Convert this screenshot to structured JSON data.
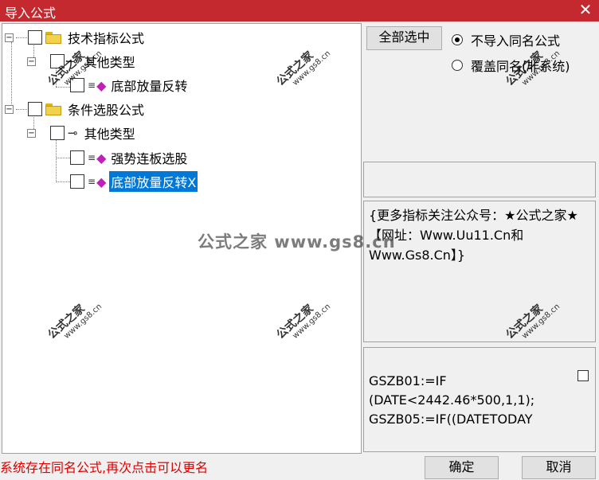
{
  "window": {
    "title": "导入公式",
    "close_glyph": "✕"
  },
  "tree": {
    "group1": {
      "label": "技术指标公式",
      "expander": "−"
    },
    "group1_type": {
      "label": "其他类型",
      "expander": "−"
    },
    "group1_item1": {
      "label": "底部放量反转"
    },
    "group2": {
      "label": "条件选股公式",
      "expander": "−"
    },
    "group2_type": {
      "label": "其他类型",
      "expander": "−"
    },
    "group2_item1": {
      "label": "强势连板选股"
    },
    "group2_item2": {
      "label": "底部放量反转X"
    }
  },
  "controls": {
    "select_all": "全部选中",
    "radio_no_import": "不导入同名公式",
    "radio_overwrite": "覆盖同名(非系统)",
    "radio_selected": "no_import"
  },
  "description": {
    "text": "{更多指标关注公众号：★公式之家★【网址：Www.Uu11.Cn和Www.Gs8.Cn】}"
  },
  "code": {
    "line1": "GSZB01:=IF",
    "line2": "(DATE<2442.46*500,1,1);",
    "line3": "GSZB05:=IF((DATETODAY"
  },
  "status": {
    "message": "系统存在同名公式,再次点击可以更名"
  },
  "buttons": {
    "ok": "确定",
    "cancel": "取消"
  },
  "watermark": {
    "main": "公式之家 www.gs8.cn",
    "stamp_cn": "公式之家",
    "stamp_url": "www.gs8.cn"
  },
  "icons": {
    "folder": "folder-icon",
    "key": "key-icon",
    "formula": "formula-gem-icon"
  },
  "colors": {
    "titlebar": "#c4292f",
    "selection": "#0078d7",
    "status_text": "#e00000",
    "gem": "#c020b8"
  }
}
